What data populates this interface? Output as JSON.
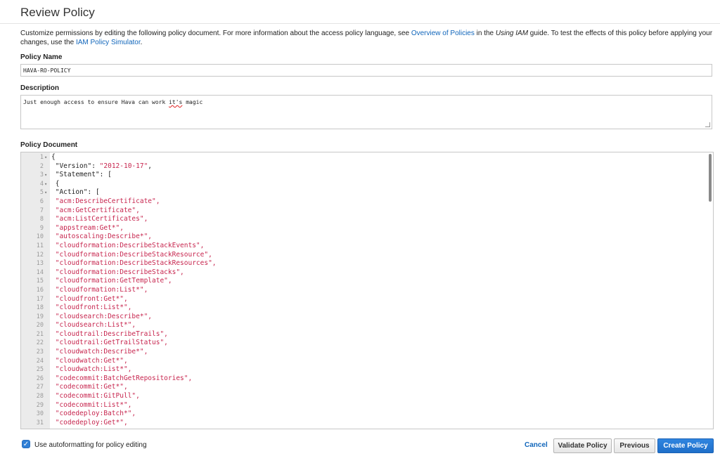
{
  "header": {
    "title": "Review Policy"
  },
  "intro": {
    "text1": "Customize permissions by editing the following policy document. For more information about the access policy language, see ",
    "link1": "Overview of Policies",
    "text2": " in the ",
    "italic": "Using IAM",
    "text3": " guide. To test the effects of this policy before applying your changes, use the ",
    "link2": "IAM Policy Simulator",
    "text4": "."
  },
  "policy_name": {
    "label": "Policy Name",
    "value": "HAVA-RO-POLICY"
  },
  "description": {
    "label": "Description",
    "value_before": "Just enough access to ensure Hava can work ",
    "value_underlined": "it's",
    "value_after": " magic"
  },
  "policy_document": {
    "label": "Policy Document",
    "lines": [
      {
        "n": "1",
        "fold": "▾",
        "indent": "",
        "text": "{",
        "str": false
      },
      {
        "n": "2",
        "fold": "",
        "indent": " ",
        "key": "\"Version\": ",
        "val": "\"2012-10-17\"",
        "tail": ","
      },
      {
        "n": "3",
        "fold": "▾",
        "indent": " ",
        "text": "\"Statement\": [",
        "str": false
      },
      {
        "n": "4",
        "fold": "▾",
        "indent": " ",
        "text": "{",
        "str": false
      },
      {
        "n": "5",
        "fold": "▾",
        "indent": " ",
        "text": "\"Action\": [",
        "str": false
      },
      {
        "n": "6",
        "fold": "",
        "indent": " ",
        "text": "\"acm:DescribeCertificate\",",
        "str": true
      },
      {
        "n": "7",
        "fold": "",
        "indent": " ",
        "text": "\"acm:GetCertificate\",",
        "str": true
      },
      {
        "n": "8",
        "fold": "",
        "indent": " ",
        "text": "\"acm:ListCertificates\",",
        "str": true
      },
      {
        "n": "9",
        "fold": "",
        "indent": " ",
        "text": "\"appstream:Get*\",",
        "str": true
      },
      {
        "n": "10",
        "fold": "",
        "indent": " ",
        "text": "\"autoscaling:Describe*\",",
        "str": true
      },
      {
        "n": "11",
        "fold": "",
        "indent": " ",
        "text": "\"cloudformation:DescribeStackEvents\",",
        "str": true
      },
      {
        "n": "12",
        "fold": "",
        "indent": " ",
        "text": "\"cloudformation:DescribeStackResource\",",
        "str": true
      },
      {
        "n": "13",
        "fold": "",
        "indent": " ",
        "text": "\"cloudformation:DescribeStackResources\",",
        "str": true
      },
      {
        "n": "14",
        "fold": "",
        "indent": " ",
        "text": "\"cloudformation:DescribeStacks\",",
        "str": true
      },
      {
        "n": "15",
        "fold": "",
        "indent": " ",
        "text": "\"cloudformation:GetTemplate\",",
        "str": true
      },
      {
        "n": "16",
        "fold": "",
        "indent": " ",
        "text": "\"cloudformation:List*\",",
        "str": true
      },
      {
        "n": "17",
        "fold": "",
        "indent": " ",
        "text": "\"cloudfront:Get*\",",
        "str": true
      },
      {
        "n": "18",
        "fold": "",
        "indent": " ",
        "text": "\"cloudfront:List*\",",
        "str": true
      },
      {
        "n": "19",
        "fold": "",
        "indent": " ",
        "text": "\"cloudsearch:Describe*\",",
        "str": true
      },
      {
        "n": "20",
        "fold": "",
        "indent": " ",
        "text": "\"cloudsearch:List*\",",
        "str": true
      },
      {
        "n": "21",
        "fold": "",
        "indent": " ",
        "text": "\"cloudtrail:DescribeTrails\",",
        "str": true
      },
      {
        "n": "22",
        "fold": "",
        "indent": " ",
        "text": "\"cloudtrail:GetTrailStatus\",",
        "str": true
      },
      {
        "n": "23",
        "fold": "",
        "indent": " ",
        "text": "\"cloudwatch:Describe*\",",
        "str": true
      },
      {
        "n": "24",
        "fold": "",
        "indent": " ",
        "text": "\"cloudwatch:Get*\",",
        "str": true
      },
      {
        "n": "25",
        "fold": "",
        "indent": " ",
        "text": "\"cloudwatch:List*\",",
        "str": true
      },
      {
        "n": "26",
        "fold": "",
        "indent": " ",
        "text": "\"codecommit:BatchGetRepositories\",",
        "str": true
      },
      {
        "n": "27",
        "fold": "",
        "indent": " ",
        "text": "\"codecommit:Get*\",",
        "str": true
      },
      {
        "n": "28",
        "fold": "",
        "indent": " ",
        "text": "\"codecommit:GitPull\",",
        "str": true
      },
      {
        "n": "29",
        "fold": "",
        "indent": " ",
        "text": "\"codecommit:List*\",",
        "str": true
      },
      {
        "n": "30",
        "fold": "",
        "indent": " ",
        "text": "\"codedeploy:Batch*\",",
        "str": true
      },
      {
        "n": "31",
        "fold": "",
        "indent": " ",
        "text": "\"codedeploy:Get*\",",
        "str": true
      }
    ]
  },
  "footer": {
    "autoformat_label": "Use autoformatting for policy editing",
    "autoformat_checked": true,
    "cancel_label": "Cancel",
    "validate_label": "Validate Policy",
    "previous_label": "Previous",
    "create_label": "Create Policy"
  },
  "colors": {
    "link": "#1166bb",
    "string": "#c7254e",
    "primary_button": "#1f6fc9"
  }
}
